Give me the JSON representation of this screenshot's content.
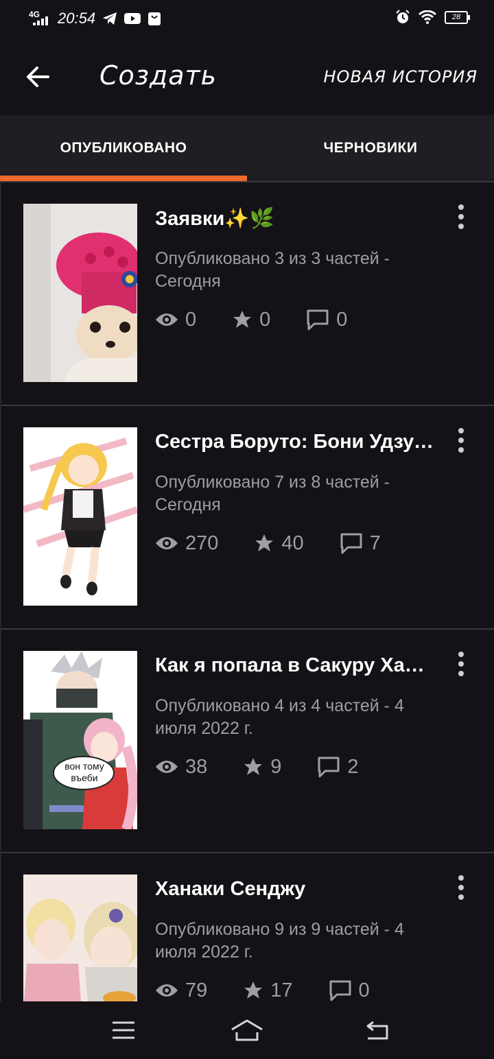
{
  "status_bar": {
    "network": "4G",
    "time": "20:54",
    "battery": "28",
    "icons": [
      "telegram-icon",
      "youtube-icon",
      "shopping-bag-icon",
      "alarm-icon",
      "wifi-icon"
    ]
  },
  "app_bar": {
    "title": "Создать",
    "new_story": "НОВАЯ ИСТОРИЯ"
  },
  "tabs": [
    {
      "label": "ОПУБЛИКОВАНО",
      "selected": true
    },
    {
      "label": "ЧЕРНОВИКИ",
      "selected": false
    }
  ],
  "colors": {
    "accent": "#f06b2b",
    "background": "#141216",
    "tab_bar": "#201e22",
    "muted_text": "#a09da3"
  },
  "stories": [
    {
      "title": "Заявки✨🌿",
      "meta": "Опубликовано 3 из 3 частей - Сегодня",
      "views": "0",
      "votes": "0",
      "comments": "0"
    },
    {
      "title": "Сестра Боруто: Бони Удзумаки",
      "meta": "Опубликовано 7 из 8 частей - Сегодня",
      "views": "270",
      "votes": "40",
      "comments": "7"
    },
    {
      "title": "Как я попала в Сакуру Харуно",
      "meta": "Опубликовано 4 из 4 частей - 4 июля 2022 г.",
      "views": "38",
      "votes": "9",
      "comments": "2",
      "cover_caption": "вон тому въеби"
    },
    {
      "title": "Ханаки Сенджу",
      "meta": "Опубликовано 9 из 9 частей - 4 июля 2022 г.",
      "views": "79",
      "votes": "17",
      "comments": "0"
    }
  ]
}
